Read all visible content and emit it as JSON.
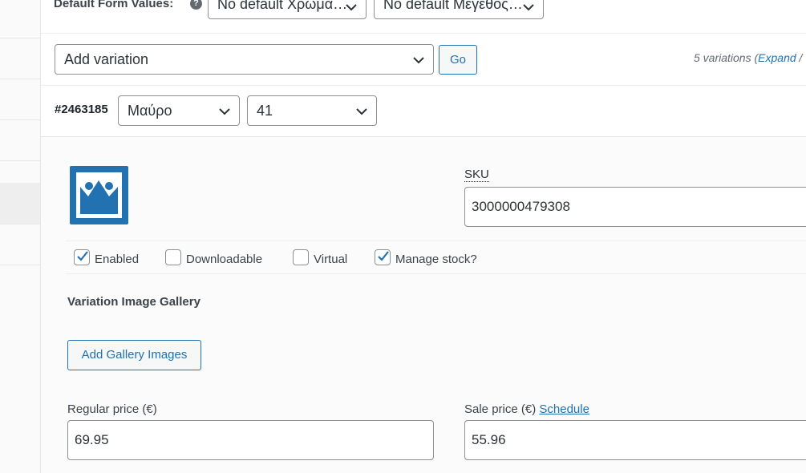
{
  "default_form_values": {
    "label": "Default Form Values:",
    "help_icon": "question-circle-icon",
    "color_select": "No default Χρώμα…",
    "size_select": "No default Μέγεθος…"
  },
  "add_variation": {
    "select_value": "Add variation",
    "go_label": "Go",
    "count_text": "5 variations (",
    "expand_link": "Expand",
    "count_suffix": " /"
  },
  "variation": {
    "id": "#2463185",
    "color_value": "Μαύρο",
    "size_value": "41",
    "sku_label": "SKU",
    "sku_value": "3000000479308",
    "options": {
      "enabled": {
        "label": "Enabled",
        "checked": true
      },
      "downloadable": {
        "label": "Downloadable",
        "checked": false
      },
      "virtual": {
        "label": "Virtual",
        "checked": false
      },
      "manage_stock": {
        "label": "Manage stock?",
        "checked": true
      }
    },
    "gallery_label": "Variation Image Gallery",
    "gallery_button": "Add Gallery Images",
    "regular_price_label": "Regular price (€)",
    "regular_price_value": "69.95",
    "sale_price_label": "Sale price (€)",
    "schedule_link": "Schedule",
    "sale_price_value": "55.96"
  },
  "colors": {
    "accent": "#2271b1",
    "check": "#2271b1"
  }
}
